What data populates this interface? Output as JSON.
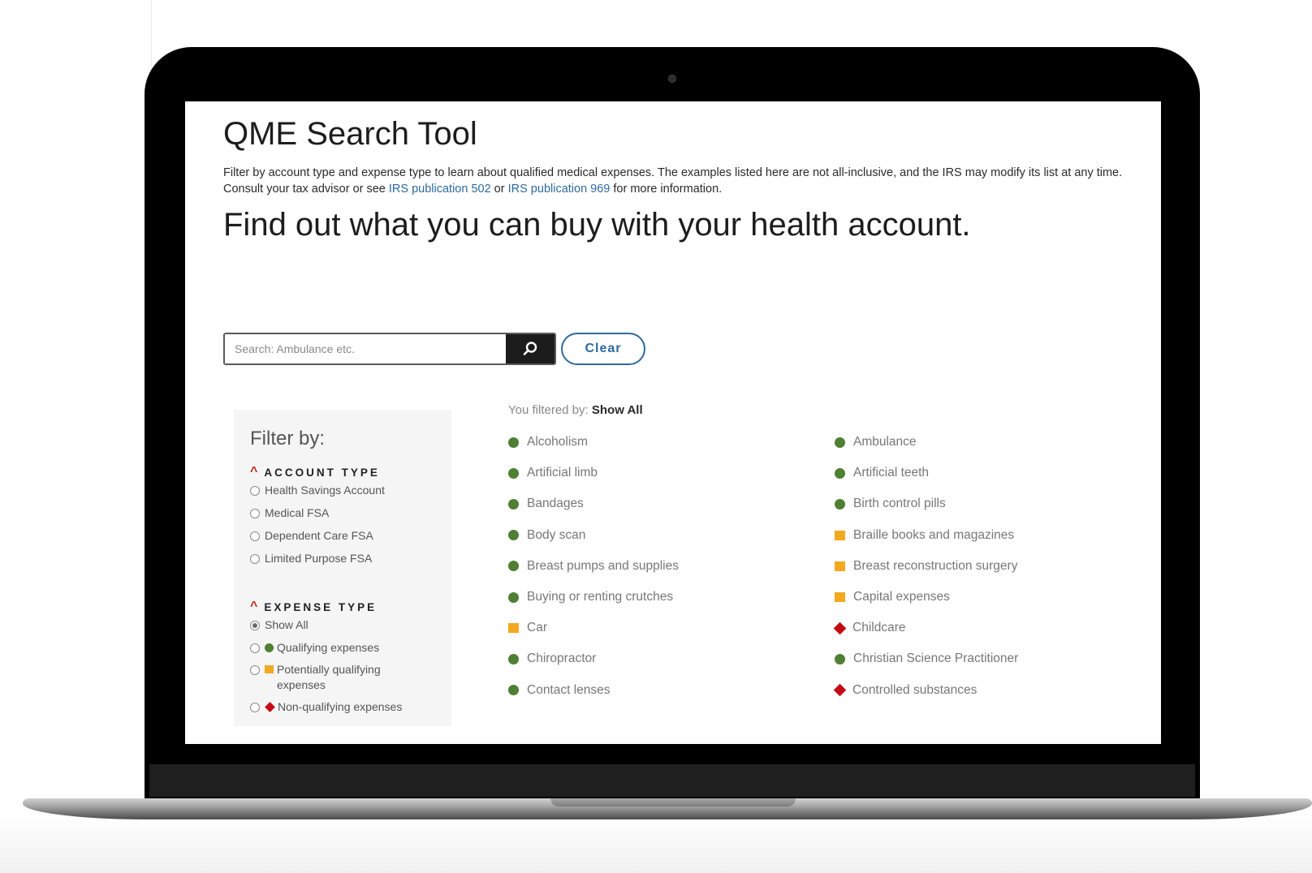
{
  "app": {
    "title": "QME Search Tool",
    "intro": {
      "text_before_link1": "Filter by account type and expense type to learn about qualified medical expenses. The examples listed here are not all-inclusive, and the IRS may modify its list at any time. Consult your tax advisor or see ",
      "link1": "IRS publication 502",
      "text_between": " or ",
      "link2": "IRS publication 969",
      "text_after": " for more information."
    },
    "headline": "Find out what you can buy with your health account."
  },
  "search": {
    "placeholder": "Search: Ambulance etc.",
    "value": "",
    "button_icon": "search-icon",
    "clear_label": "Clear"
  },
  "filters": {
    "title": "Filter by:",
    "account_type": {
      "heading": "ACCOUNT TYPE",
      "options": [
        "Health Savings Account",
        "Medical FSA",
        "Dependent Care FSA",
        "Limited Purpose FSA"
      ]
    },
    "expense_type": {
      "heading": "EXPENSE TYPE",
      "selected": "Show All",
      "options": [
        {
          "label": "Show All",
          "icon": ""
        },
        {
          "label": "Qualifying expenses",
          "icon": "green-circle-icon"
        },
        {
          "label": "Potentially qualifying expenses",
          "icon": "orange-square-icon"
        },
        {
          "label": "Non-qualifying expenses",
          "icon": "red-diamond-icon"
        }
      ]
    }
  },
  "status": {
    "filtered_by_label": "You filtered by:",
    "filtered_by_value": "Show All"
  },
  "results": {
    "column1": [
      {
        "label": "Alcoholism",
        "status": "qualifying"
      },
      {
        "label": "Artificial limb",
        "status": "qualifying"
      },
      {
        "label": "Bandages",
        "status": "qualifying"
      },
      {
        "label": "Body scan",
        "status": "qualifying"
      },
      {
        "label": "Breast pumps and supplies",
        "status": "qualifying"
      },
      {
        "label": "Buying or renting crutches",
        "status": "qualifying"
      },
      {
        "label": "Car",
        "status": "potentially"
      },
      {
        "label": "Chiropractor",
        "status": "qualifying"
      },
      {
        "label": "Contact lenses",
        "status": "qualifying"
      }
    ],
    "column2": [
      {
        "label": "Ambulance",
        "status": "qualifying"
      },
      {
        "label": "Artificial teeth",
        "status": "qualifying"
      },
      {
        "label": "Birth control pills",
        "status": "qualifying"
      },
      {
        "label": "Braille books and magazines",
        "status": "potentially"
      },
      {
        "label": "Breast reconstruction surgery",
        "status": "potentially"
      },
      {
        "label": "Capital expenses",
        "status": "potentially"
      },
      {
        "label": "Childcare",
        "status": "non-qualifying"
      },
      {
        "label": "Christian Science Practitioner",
        "status": "qualifying"
      },
      {
        "label": "Controlled substances",
        "status": "non-qualifying"
      }
    ]
  },
  "colors": {
    "qualifying": "#4f7f33",
    "potentially": "#f2a91f",
    "non_qualifying": "#c40b14",
    "link": "#2d6a9f"
  }
}
